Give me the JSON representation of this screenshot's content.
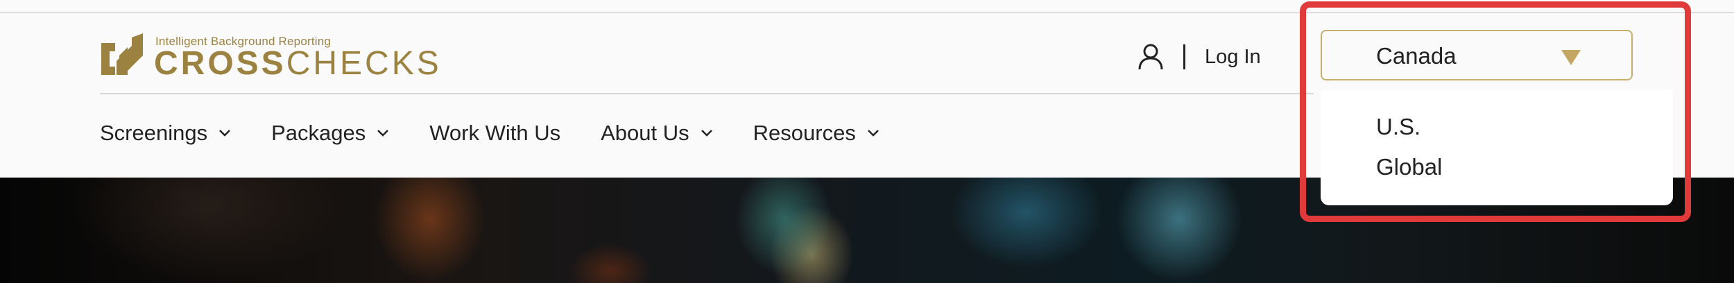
{
  "brand": {
    "tagline": "Intelligent Background Reporting",
    "name_bold": "CROSS",
    "name_light": "CHECKS",
    "color": "#9c8241"
  },
  "header": {
    "login_label": "Log In",
    "user_icon": "user-icon"
  },
  "nav": {
    "items": [
      {
        "label": "Screenings",
        "has_dropdown": true
      },
      {
        "label": "Packages",
        "has_dropdown": true
      },
      {
        "label": "Work With Us",
        "has_dropdown": false
      },
      {
        "label": "About Us",
        "has_dropdown": true
      },
      {
        "label": "Resources",
        "has_dropdown": true
      }
    ]
  },
  "region_select": {
    "selected": "Canada",
    "options": [
      "U.S.",
      "Global"
    ],
    "accent": "#c5a764"
  },
  "highlight": {
    "color": "#e03a3a"
  }
}
